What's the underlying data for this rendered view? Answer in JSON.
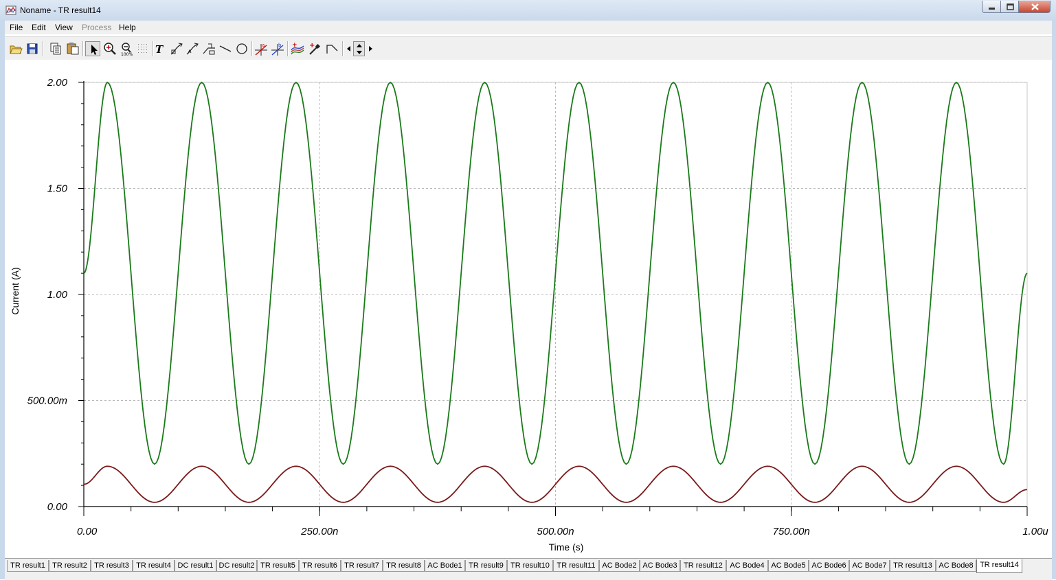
{
  "window": {
    "title": "Noname - TR result14",
    "icon": "chart-app-icon",
    "controls": [
      "minimize-icon",
      "maximize-icon",
      "close-icon"
    ]
  },
  "menu": {
    "items": [
      {
        "label": "File",
        "enabled": true
      },
      {
        "label": "Edit",
        "enabled": true
      },
      {
        "label": "View",
        "enabled": true
      },
      {
        "label": "Process",
        "enabled": false
      },
      {
        "label": "Help",
        "enabled": true
      }
    ]
  },
  "toolbar": {
    "buttons": [
      "open-icon",
      "save-icon",
      "copy-icon",
      "paste-icon",
      "select-arrow-icon",
      "zoom-in-icon",
      "zoom-100-icon",
      "grid-icon",
      "text-icon",
      "cursor-a-icon",
      "cursor-b-icon",
      "annotate-icon",
      "line-icon",
      "ellipse-icon",
      "marker-a-icon",
      "marker-b-icon",
      "curves-icon",
      "probe-icon",
      "step-icon",
      "scroll-left-icon",
      "scroll-updown-icon",
      "scroll-right-icon"
    ]
  },
  "chart_data": {
    "type": "line",
    "xlabel": "Time (s)",
    "ylabel": "Current (A)",
    "xlim": [
      0,
      1e-06
    ],
    "ylim": [
      0,
      2
    ],
    "x_ticks": [
      {
        "value": 0,
        "label": "0.00"
      },
      {
        "value": 2.5e-07,
        "label": "250.00n"
      },
      {
        "value": 5e-07,
        "label": "500.00n"
      },
      {
        "value": 7.5e-07,
        "label": "750.00n"
      },
      {
        "value": 1e-06,
        "label": "1.00u"
      }
    ],
    "y_ticks": [
      {
        "value": 0,
        "label": "0.00"
      },
      {
        "value": 0.5,
        "label": "500.00m"
      },
      {
        "value": 1,
        "label": "1.00"
      },
      {
        "value": 1.5,
        "label": "1.50"
      },
      {
        "value": 2,
        "label": "2.00"
      }
    ],
    "grid": true,
    "series": [
      {
        "color": "#1a7a1a",
        "x": [
          0,
          2.5e-08,
          7.5e-08,
          1.25e-07,
          1.75e-07,
          2.25e-07,
          2.75e-07,
          3.25e-07,
          3.75e-07,
          4.25e-07,
          4.75e-07,
          5.25e-07,
          5.75e-07,
          6.25e-07,
          6.75e-07,
          7.25e-07,
          7.75e-07,
          8.25e-07,
          8.75e-07,
          9.25e-07,
          9.75e-07,
          1e-06
        ],
        "y": [
          1.1,
          2.0,
          0.2,
          2.0,
          0.2,
          2.0,
          0.2,
          2.0,
          0.2,
          2.0,
          0.2,
          2.0,
          0.2,
          2.0,
          0.2,
          2.0,
          0.2,
          2.0,
          0.2,
          2.0,
          0.2,
          1.1
        ]
      },
      {
        "color": "#7a1a1a",
        "x": [
          0,
          2.5e-08,
          7.5e-08,
          1.25e-07,
          1.75e-07,
          2.25e-07,
          2.75e-07,
          3.25e-07,
          3.75e-07,
          4.25e-07,
          4.75e-07,
          5.25e-07,
          5.75e-07,
          6.25e-07,
          6.75e-07,
          7.25e-07,
          7.75e-07,
          8.25e-07,
          8.75e-07,
          9.25e-07,
          9.75e-07,
          1e-06
        ],
        "y": [
          0.105,
          0.19,
          0.02,
          0.19,
          0.02,
          0.19,
          0.02,
          0.19,
          0.02,
          0.19,
          0.02,
          0.19,
          0.02,
          0.19,
          0.02,
          0.19,
          0.02,
          0.19,
          0.02,
          0.19,
          0.02,
          0.08
        ]
      }
    ]
  },
  "tabs": [
    {
      "label": "TR result1"
    },
    {
      "label": "TR result2"
    },
    {
      "label": "TR result3"
    },
    {
      "label": "TR result4"
    },
    {
      "label": "DC result1"
    },
    {
      "label": "DC result2"
    },
    {
      "label": "TR result5"
    },
    {
      "label": "TR result6"
    },
    {
      "label": "TR result7"
    },
    {
      "label": "TR result8"
    },
    {
      "label": "AC Bode1"
    },
    {
      "label": "TR result9"
    },
    {
      "label": "TR result10"
    },
    {
      "label": "TR result11"
    },
    {
      "label": "AC Bode2"
    },
    {
      "label": "AC Bode3"
    },
    {
      "label": "TR result12"
    },
    {
      "label": "AC Bode4"
    },
    {
      "label": "AC Bode5"
    },
    {
      "label": "AC Bode6"
    },
    {
      "label": "AC Bode7"
    },
    {
      "label": "TR result13"
    },
    {
      "label": "AC Bode8"
    },
    {
      "label": "TR result14"
    }
  ],
  "active_tab": "TR result14"
}
